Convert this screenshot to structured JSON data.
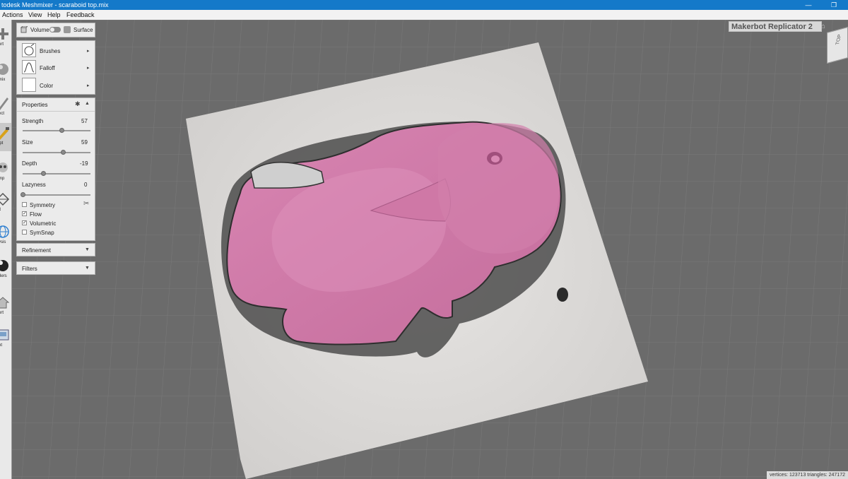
{
  "window": {
    "title": "todesk Meshmixer - scaraboid top.mix",
    "minimize_glyph": "—",
    "restore_glyph": "❐"
  },
  "menu": [
    "Actions",
    "View",
    "Help",
    "Feedback"
  ],
  "toolbar": {
    "items": [
      {
        "label": "ort",
        "icon": "plus-icon"
      },
      {
        "label": "mix",
        "icon": "meshmix-sphere-icon"
      },
      {
        "label": "ect",
        "icon": "select-brush-icon"
      },
      {
        "label": "lpt",
        "icon": "sculpt-brush-icon"
      },
      {
        "label": "mp",
        "icon": "stamp-skull-icon"
      },
      {
        "label": "it",
        "icon": "edit-mesh-icon"
      },
      {
        "label": "ysis",
        "icon": "analysis-globe-icon"
      },
      {
        "label": "ders",
        "icon": "shaders-sphere-icon"
      },
      {
        "label": "ort",
        "icon": "export-icon"
      },
      {
        "label": "nt",
        "icon": "print-icon"
      }
    ]
  },
  "mode_toggle": {
    "volume_label": "Volume",
    "surface_label": "Surface"
  },
  "brush_panel": {
    "brushes_label": "Brushes",
    "falloff_label": "Falloff",
    "color_label": "Color"
  },
  "properties": {
    "title": "Properties",
    "strength": {
      "label": "Strength",
      "value": "57",
      "fraction": 0.57
    },
    "size": {
      "label": "Size",
      "value": "59",
      "fraction": 0.59
    },
    "depth": {
      "label": "Depth",
      "value": "-19",
      "fraction": 0.3
    },
    "lazyness": {
      "label": "Lazyness",
      "value": "0",
      "fraction": 0.0
    },
    "symmetry": {
      "label": "Symmetry",
      "checked": false
    },
    "flow": {
      "label": "Flow",
      "checked": true
    },
    "volumetric": {
      "label": "Volumetric",
      "checked": true
    },
    "symsnap": {
      "label": "SymSnap",
      "checked": false
    }
  },
  "refinement": {
    "title": "Refinement"
  },
  "filters": {
    "title": "Filters"
  },
  "printer": {
    "name": "Makerbot Replicator 2"
  },
  "view_cube": {
    "label": "TOP"
  },
  "stats": {
    "text": "vertices: 123713 triangles: 247172"
  },
  "colors": {
    "titlebar": "#1479c9",
    "viewport": "#6b6b6b",
    "model_pink": "#d07aa6",
    "bed": "#d9d7d5"
  }
}
